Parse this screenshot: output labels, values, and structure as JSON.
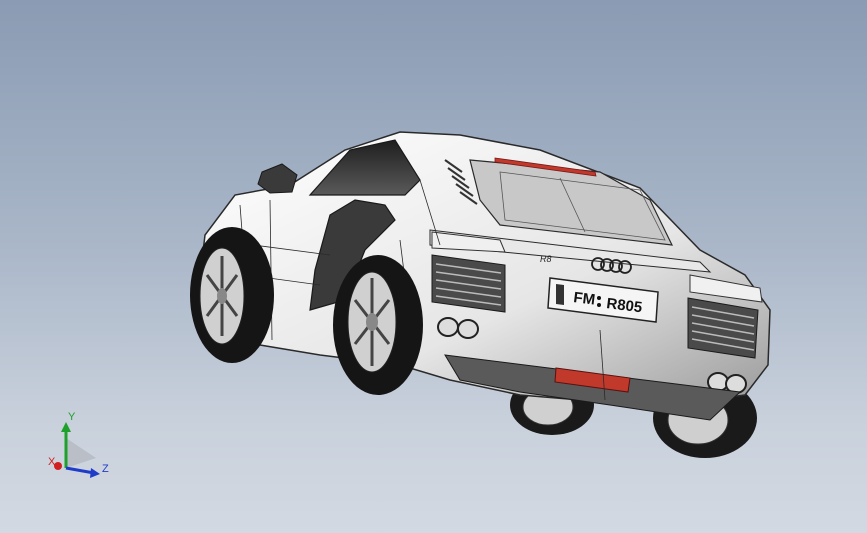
{
  "viewport": {
    "background_top": "#8a9bb3",
    "background_bottom": "#d3d9e2"
  },
  "model": {
    "license_plate": "FM • R805",
    "plate_left": "FM",
    "plate_right": "R805",
    "badge": "R8",
    "body_color": "#f2f2f2",
    "glass_color": "#3a3a3a",
    "edge_color": "#2a2a2a",
    "light_bar_color": "#c0392b"
  },
  "triad": {
    "x_label": "X",
    "y_label": "Y",
    "z_label": "Z",
    "x_color": "#d12020",
    "y_color": "#1fa02a",
    "z_color": "#1f3cc8"
  }
}
